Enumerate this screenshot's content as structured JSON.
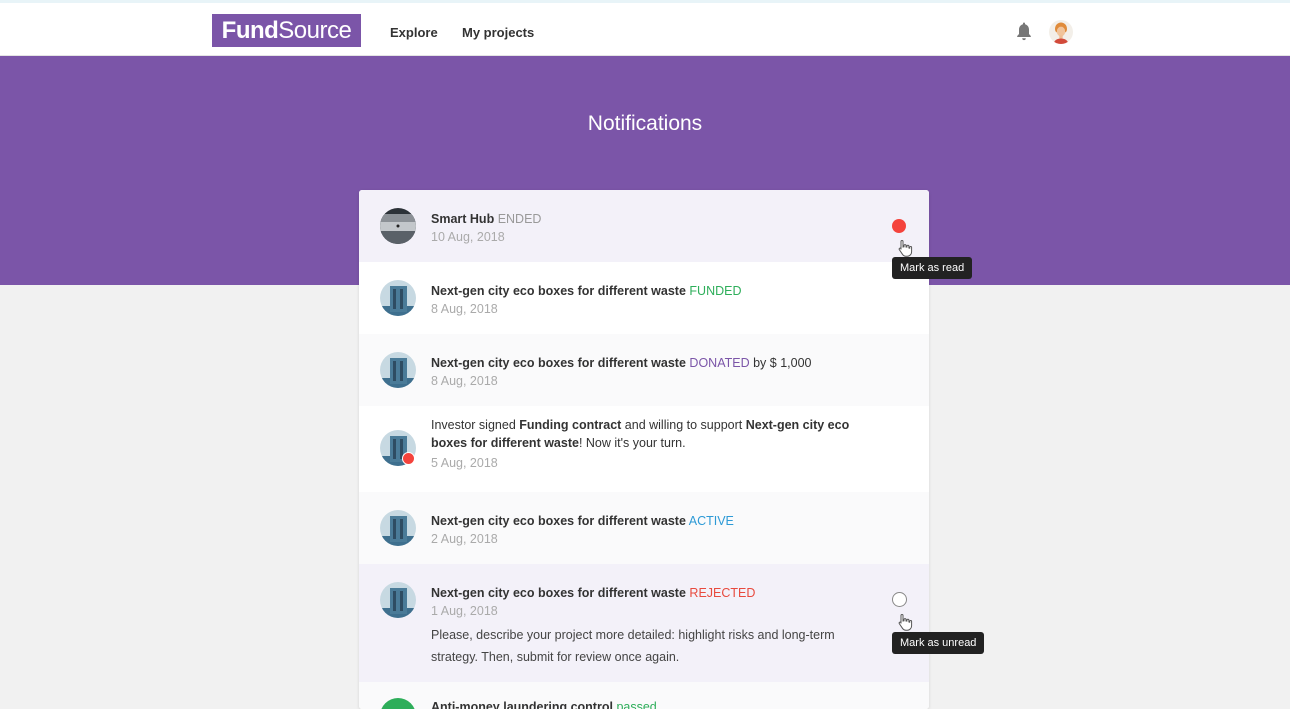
{
  "app": {
    "logo_bold": "Fund",
    "logo_light": "Source"
  },
  "nav": {
    "explore": "Explore",
    "my_projects": "My projects"
  },
  "header": {
    "bell_icon": "bell-icon",
    "avatar": "user-avatar"
  },
  "hero": {
    "title": "Notifications"
  },
  "colors": {
    "brand": "#7b55a8",
    "funded": "#2eae5a",
    "active": "#2d9ad6",
    "rejected": "#e84a3e",
    "unread_dot": "#f4433c"
  },
  "notifications": [
    {
      "project": "Smart Hub",
      "status": "ENDED",
      "date": "10 Aug, 2018",
      "unread": true,
      "tooltip": "Mark as read"
    },
    {
      "project": "Next-gen city eco boxes for different waste",
      "status": "FUNDED",
      "date": "8 Aug, 2018"
    },
    {
      "project": "Next-gen city eco boxes for different waste",
      "status": "DONATED",
      "suffix": "by $ 1,000",
      "date": "8 Aug, 2018"
    },
    {
      "text_prefix": "Investor signed ",
      "bold1": "Funding contract",
      "text_mid": " and willing to support ",
      "bold2_line1": "Next-gen city eco",
      "bold2_line2": "boxes for different waste",
      "text_end": "! Now it's your turn.",
      "date": "5 Aug, 2018"
    },
    {
      "project": "Next-gen city eco boxes for different waste",
      "status": "ACTIVE",
      "date": "2 Aug, 2018"
    },
    {
      "project": "Next-gen city eco boxes for different waste",
      "status": "REJECTED",
      "date": "1 Aug, 2018",
      "message_line1": "Please, describe your project more detailed: highlight risks and long-term",
      "message_line2": "strategy. Then, submit for review once again.",
      "unread": false,
      "tooltip": "Mark as unread"
    },
    {
      "project": "Anti-money laundering control",
      "status": "passed"
    }
  ]
}
